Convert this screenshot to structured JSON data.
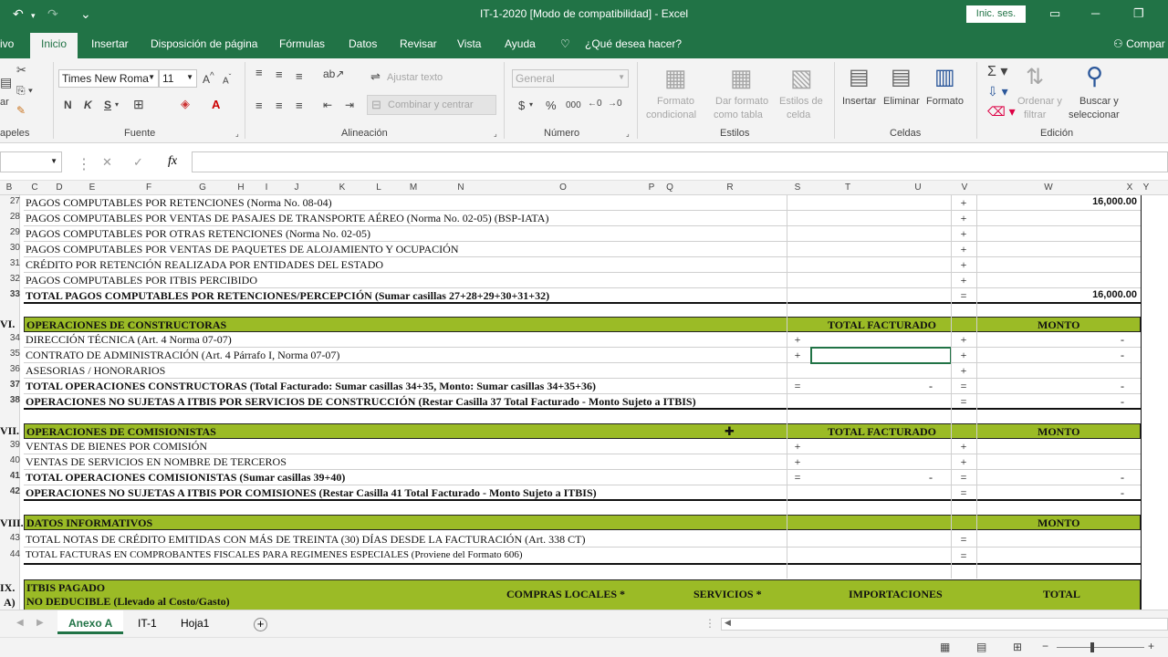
{
  "window": {
    "title": "IT-1-2020  [Modo de compatibilidad]  -  Excel",
    "signin": "Inic. ses.",
    "undo_icon": "↶",
    "redo_icon": "↷",
    "qa_icon": "⌄"
  },
  "tabs": {
    "archivo": "ivo",
    "inicio": "Inicio",
    "insertar": "Insertar",
    "disposicion": "Disposición de página",
    "formulas": "Fórmulas",
    "datos": "Datos",
    "revisar": "Revisar",
    "vista": "Vista",
    "ayuda": "Ayuda",
    "tellme": "¿Qué desea hacer?",
    "compartir": "Compar"
  },
  "ribbon": {
    "clipboard_label": "apeles",
    "font_name": "Times New Roma",
    "font_size": "11",
    "font_label": "Fuente",
    "bold": "N",
    "italic": "K",
    "underline": "S",
    "wrap_text": "Ajustar texto",
    "merge_center": "Combinar y centrar",
    "align_label": "Alineación",
    "number_format": "General",
    "currency": "$",
    "percent": "%",
    "thousands": "000",
    "number_label": "Número",
    "cond_format_1": "Formato",
    "cond_format_2": "condicional",
    "table_format_1": "Dar formato",
    "table_format_2": "como tabla",
    "cell_styles_1": "Estilos de",
    "cell_styles_2": "celda",
    "styles_label": "Estilos",
    "insert": "Insertar",
    "delete": "Eliminar",
    "format": "Formato",
    "cells_label": "Celdas",
    "sort_1": "Ordenar y",
    "sort_2": "filtrar",
    "find_1": "Buscar y",
    "find_2": "seleccionar",
    "editing_label": "Edición",
    "paste": "ar"
  },
  "formula_bar": {
    "namebox": "",
    "fx": "fx",
    "cancel": "✕",
    "enter": "✓",
    "content": ""
  },
  "columns": [
    "B",
    "C",
    "D",
    "E",
    "F",
    "G",
    "H",
    "I",
    "J",
    "K",
    "L",
    "M",
    "N",
    "O",
    "P",
    "Q",
    "R",
    "S",
    "T",
    "U",
    "V",
    "W",
    "X",
    "Y"
  ],
  "rows": [
    {
      "n": "27",
      "desc": "PAGOS COMPUTABLES POR RETENCIONES (Norma No. 08-04)",
      "sym": "+",
      "val": "16,000.00"
    },
    {
      "n": "28",
      "desc": "PAGOS COMPUTABLES POR VENTAS DE PASAJES DE TRANSPORTE AÉREO (Norma No. 02-05) (BSP-IATA)",
      "sym": "+",
      "val": ""
    },
    {
      "n": "29",
      "desc": "PAGOS COMPUTABLES POR OTRAS RETENCIONES (Norma No. 02-05)",
      "sym": "+",
      "val": ""
    },
    {
      "n": "30",
      "desc": "PAGOS COMPUTABLES POR VENTAS DE PAQUETES DE ALOJAMIENTO Y OCUPACIÓN",
      "sym": "+",
      "val": ""
    },
    {
      "n": "31",
      "desc": "CRÉDITO POR RETENCIÓN REALIZADA POR ENTIDADES DEL ESTADO",
      "sym": "+",
      "val": ""
    },
    {
      "n": "32",
      "desc": "PAGOS COMPUTABLES POR ITBIS PERCIBIDO",
      "sym": "+",
      "val": ""
    },
    {
      "n": "33",
      "desc": "TOTAL PAGOS COMPUTABLES POR RETENCIONES/PERCEPCIÓN (Sumar casillas 27+28+29+30+31+32)",
      "sym": "=",
      "val": "16,000.00"
    }
  ],
  "sec6": {
    "roman": "VI.",
    "title": "OPERACIONES DE CONSTRUCTORAS",
    "col_total": "TOTAL FACTURADO",
    "col_monto": "MONTO",
    "rows": [
      {
        "n": "34",
        "desc": "DIRECCIÓN TÉCNICA (Art. 4 Norma 07-07)",
        "s1": "+",
        "s2": "+",
        "d1": "",
        "d2": "-"
      },
      {
        "n": "35",
        "desc": "CONTRATO DE ADMINISTRACIÓN (Art. 4 Párrafo I, Norma 07-07)",
        "s1": "+",
        "s2": "+",
        "d1": "",
        "d2": "-"
      },
      {
        "n": "36",
        "desc": "ASESORIAS / HONORARIOS",
        "s1": "",
        "s2": "+",
        "d1": "",
        "d2": ""
      },
      {
        "n": "37",
        "desc": "TOTAL OPERACIONES CONSTRUCTORAS (Total Facturado: Sumar casillas 34+35, Monto: Sumar casillas 34+35+36)",
        "s1": "=",
        "s2": "=",
        "d1": "-",
        "d2": "-"
      },
      {
        "n": "38",
        "desc": "OPERACIONES NO SUJETAS A ITBIS POR SERVICIOS DE CONSTRUCCIÓN (Restar Casilla 37 Total Facturado - Monto Sujeto a ITBIS)",
        "s1": "",
        "s2": "=",
        "d1": "",
        "d2": "-"
      }
    ]
  },
  "sec7": {
    "roman": "VII.",
    "title": "OPERACIONES DE COMISIONISTAS",
    "col_total": "TOTAL FACTURADO",
    "col_monto": "MONTO",
    "rows": [
      {
        "n": "39",
        "desc": "VENTAS DE BIENES POR COMISIÓN",
        "s1": "+",
        "s2": "+",
        "d1": "",
        "d2": ""
      },
      {
        "n": "40",
        "desc": "VENTAS DE SERVICIOS EN NOMBRE DE TERCEROS",
        "s1": "+",
        "s2": "+",
        "d1": "",
        "d2": ""
      },
      {
        "n": "41",
        "desc": "TOTAL OPERACIONES COMISIONISTAS (Sumar casillas 39+40)",
        "s1": "=",
        "s2": "=",
        "d1": "-",
        "d2": "-"
      },
      {
        "n": "42",
        "desc": "OPERACIONES NO SUJETAS A ITBIS POR COMISIONES (Restar Casilla 41 Total Facturado - Monto Sujeto a ITBIS)",
        "s1": "",
        "s2": "=",
        "d1": "",
        "d2": "-"
      }
    ]
  },
  "sec8": {
    "roman": "VIII.",
    "title": "DATOS INFORMATIVOS",
    "col_monto": "MONTO",
    "rows": [
      {
        "n": "43",
        "desc": "TOTAL NOTAS DE CRÉDITO EMITIDAS CON MÁS DE TREINTA (30) DÍAS DESDE LA FACTURACIÓN (Art. 338 CT)",
        "s2": "="
      },
      {
        "n": "44",
        "desc": "TOTAL FACTURAS EN COMPROBANTES FISCALES PARA REGIMENES ESPECIALES (Proviene del Formato 606)",
        "s2": "="
      }
    ]
  },
  "sec9": {
    "roman": "IX.",
    "sub": "A)",
    "title": "ITBIS PAGADO",
    "subtitle": "NO DEDUCIBLE (Llevado al Costo/Gasto)",
    "c1": "COMPRAS LOCALES *",
    "c2": "SERVICIOS *",
    "c3": "IMPORTACIONES",
    "c4": "TOTAL"
  },
  "sheet_tabs": [
    "Anexo A",
    "IT-1",
    "Hoja1"
  ],
  "add_sheet": "+"
}
